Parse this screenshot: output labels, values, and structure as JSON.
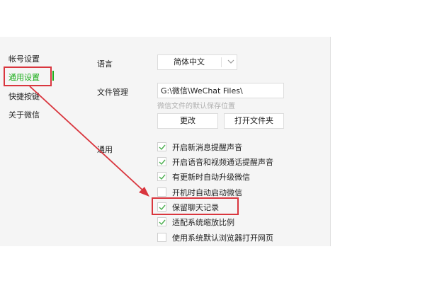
{
  "sidebar": {
    "items": [
      {
        "label": "帐号设置"
      },
      {
        "label": "通用设置"
      },
      {
        "label": "快捷按键"
      },
      {
        "label": "关于微信"
      }
    ]
  },
  "language": {
    "label": "语言",
    "selected": "简体中文"
  },
  "file_management": {
    "label": "文件管理",
    "path": "G:\\微信\\WeChat Files\\",
    "hint": "微信文件的默认保存位置",
    "change_button": "更改",
    "open_folder_button": "打开文件夹"
  },
  "general": {
    "label": "通用",
    "options": [
      {
        "label": "开启新消息提醒声音",
        "checked": true
      },
      {
        "label": "开启语音和视频通话提醒声音",
        "checked": true
      },
      {
        "label": "有更新时自动升级微信",
        "checked": true
      },
      {
        "label": "开机时自动启动微信",
        "checked": false
      },
      {
        "label": "保留聊天记录",
        "checked": true
      },
      {
        "label": "适配系统缩放比例",
        "checked": true
      },
      {
        "label": "使用系统默认浏览器打开网页",
        "checked": false
      }
    ]
  },
  "colors": {
    "accent": "#1aad19",
    "annotation": "#d9363e",
    "check": "#4caf50"
  }
}
